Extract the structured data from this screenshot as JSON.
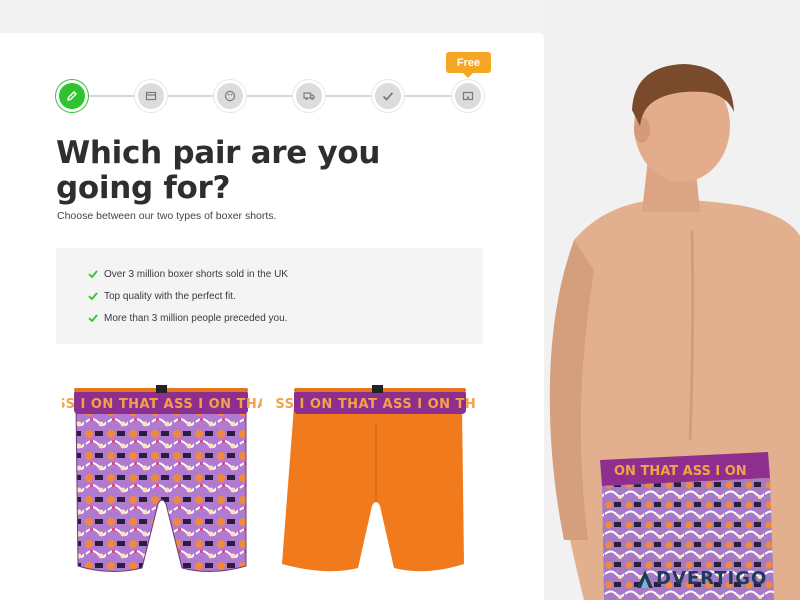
{
  "stepper": {
    "steps": [
      {
        "icon": "pencil-icon",
        "state": "active"
      },
      {
        "icon": "box-icon",
        "state": "pending"
      },
      {
        "icon": "palette-icon",
        "state": "pending"
      },
      {
        "icon": "truck-icon",
        "state": "pending"
      },
      {
        "icon": "checkmark-icon",
        "state": "pending"
      },
      {
        "icon": "boxer-icon",
        "state": "pending"
      }
    ],
    "free_badge": "Free"
  },
  "main": {
    "title": "Which pair are you going for?",
    "subtitle": "Choose between our two types of boxer shorts."
  },
  "benefits": {
    "items": [
      "Over 3 million boxer shorts sold in the UK",
      "Top quality with the perfect fit.",
      "More than 3 million people preceded you."
    ],
    "check_color": "#2fc32f"
  },
  "products": [
    {
      "name": "",
      "waistband_text": "ASS I ON THAT ASS I ON THAT",
      "style": "patterned"
    },
    {
      "name": "",
      "waistband_text": "ASS I ON THAT ASS I ON THAT",
      "style": "solid-orange"
    }
  ],
  "model": {
    "waistband_text": "ON THAT ASS I ON"
  },
  "watermark": {
    "text": "DVERTIGO"
  },
  "colors": {
    "accent_green": "#2fc32f",
    "badge_orange": "#f5a623",
    "waistband_purple": "#8e2f8f",
    "waistband_text": "#f2a34a",
    "solid_orange": "#f07a1c"
  }
}
